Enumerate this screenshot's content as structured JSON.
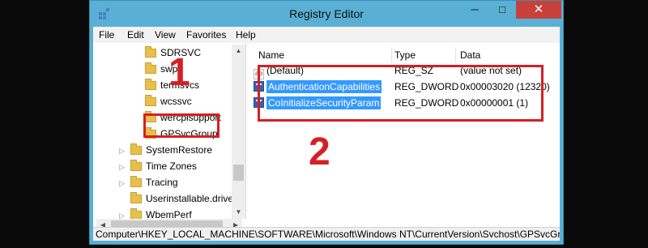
{
  "window": {
    "title": "Registry Editor",
    "caption": {
      "minimize": "─",
      "maximize": "□",
      "close": "✕"
    },
    "icon": "registry-icon"
  },
  "menu": [
    "File",
    "Edit",
    "View",
    "Favorites",
    "Help"
  ],
  "tree": {
    "items": [
      {
        "label": "SDRSVC",
        "level": 2
      },
      {
        "label": "swp",
        "level": 2
      },
      {
        "label": "termsvcs",
        "level": 2
      },
      {
        "label": "wcssvc",
        "level": 2
      },
      {
        "label": "wercplsupport",
        "level": 2
      },
      {
        "label": "GPSvcGroup",
        "level": 2,
        "highlighted": true
      },
      {
        "label": "SystemRestore",
        "level": 1,
        "expandable": true
      },
      {
        "label": "Time Zones",
        "level": 1,
        "expandable": true
      },
      {
        "label": "Tracing",
        "level": 1,
        "expandable": true
      },
      {
        "label": "Userinstallable.drivers",
        "level": 1
      },
      {
        "label": "WbemPerf",
        "level": 1,
        "expandable": true
      }
    ]
  },
  "list": {
    "columns": [
      "Name",
      "Type",
      "Data"
    ],
    "rows": [
      {
        "icon": "string-value-icon",
        "name": "(Default)",
        "type": "REG_SZ",
        "data": "(value not set)",
        "selected": false
      },
      {
        "icon": "binary-value-icon",
        "name": "AuthenticationCapabilities",
        "type": "REG_DWORD",
        "data": "0x00003020 (12320)",
        "selected": true
      },
      {
        "icon": "binary-value-icon",
        "name": "CoInitializeSecurityParam",
        "type": "REG_DWORD",
        "data": "0x00000001 (1)",
        "selected": true
      }
    ]
  },
  "status_path": "Computer\\HKEY_LOCAL_MACHINE\\SOFTWARE\\Microsoft\\Windows NT\\CurrentVersion\\Svchost\\GPSvcGroup",
  "annotations": {
    "step1": "1",
    "step2": "2",
    "color": "#d42025"
  },
  "colors": {
    "frame": "#59b0d4",
    "close": "#c7413a",
    "selection": "#3399ff",
    "folder": "#e6c04a"
  }
}
